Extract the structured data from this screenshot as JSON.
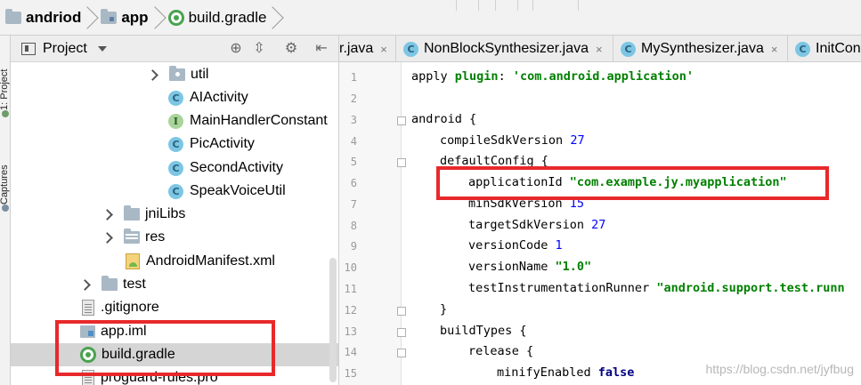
{
  "breadcrumb": {
    "items": [
      "andriod",
      "app",
      "build.gradle"
    ]
  },
  "tool_strip": {
    "tabs": [
      "1: Project",
      "Captures"
    ]
  },
  "project_panel": {
    "title": "Project",
    "header_icons": [
      "target-icon",
      "collapse-icon",
      "gear-icon",
      "hide-icon"
    ],
    "tree": [
      {
        "label": "util",
        "kind": "package",
        "expandable": true
      },
      {
        "label": "AIActivity",
        "kind": "class"
      },
      {
        "label": "MainHandlerConstant",
        "kind": "interface"
      },
      {
        "label": "PicActivity",
        "kind": "class"
      },
      {
        "label": "SecondActivity",
        "kind": "class"
      },
      {
        "label": "SpeakVoiceUtil",
        "kind": "class"
      },
      {
        "label": "jniLibs",
        "kind": "folder",
        "expandable": true
      },
      {
        "label": "res",
        "kind": "res-folder",
        "expandable": true
      },
      {
        "label": "AndroidManifest.xml",
        "kind": "manifest"
      },
      {
        "label": "test",
        "kind": "folder",
        "expandable": true
      },
      {
        "label": ".gitignore",
        "kind": "file"
      },
      {
        "label": "app.iml",
        "kind": "module"
      },
      {
        "label": "build.gradle",
        "kind": "gradle",
        "selected": true
      },
      {
        "label": "proguard-rules.pro",
        "kind": "file"
      }
    ]
  },
  "editor": {
    "tabs": [
      {
        "label": "r.java",
        "close": "×"
      },
      {
        "label": "NonBlockSynthesizer.java",
        "close": "×"
      },
      {
        "label": "MySynthesizer.java",
        "close": "×"
      },
      {
        "label": "InitCon"
      }
    ],
    "line_numbers": [
      "1",
      "2",
      "3",
      "4",
      "5",
      "6",
      "7",
      "8",
      "9",
      "10",
      "11",
      "12",
      "13",
      "14",
      "15"
    ],
    "code": {
      "l1_kw": "apply",
      "l1_prop": "plugin",
      "l1_colon": ": ",
      "l1_str": "'com.android.application'",
      "l3_head": "android {",
      "l4_key": "compileSdkVersion ",
      "l4_val": "27",
      "l5_head": "defaultConfig {",
      "l6_key": "applicationId ",
      "l6_val": "\"com.example.jy.myapplication\"",
      "l7_key": "minSdkVersion ",
      "l7_val": "15",
      "l8_key": "targetSdkVersion ",
      "l8_val": "27",
      "l9_key": "versionCode ",
      "l9_val": "1",
      "l10_key": "versionName ",
      "l10_val": "\"1.0\"",
      "l11_key": "testInstrumentationRunner ",
      "l11_val": "\"android.support.test.runn",
      "l12_close": "}",
      "l13_head": "buildTypes {",
      "l14_head": "release {",
      "l15_key": "minifyEnabled ",
      "l15_val": "false"
    }
  },
  "watermark": "https://blog.csdn.net/jyfbug",
  "colors": {
    "highlight_border": "#e8292b",
    "selection": "#d5d5d5",
    "string": "#008000",
    "keyword": "#000080",
    "number": "#0000ff"
  }
}
